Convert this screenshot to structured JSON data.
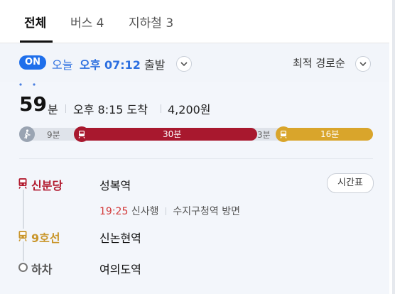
{
  "tabs": [
    {
      "label": "전체",
      "active": true
    },
    {
      "label": "버스 4",
      "active": false
    },
    {
      "label": "지하철 3",
      "active": false
    }
  ],
  "options": {
    "toggle_label": "ON",
    "departure_day": "오늘",
    "departure_time": "오후 07:12",
    "departure_suffix": "출발",
    "sort_label": "최적 경로순"
  },
  "route": {
    "duration_value": "59",
    "duration_unit": "분",
    "arrival": "오후 8:15 도착",
    "fare": "4,200원",
    "segments": {
      "walk_label": "9분",
      "red_label": "30분",
      "transfer_label": "3분",
      "gold_label": "16분"
    },
    "steps": [
      {
        "line": "신분당",
        "station": "성복역",
        "line_color": "#b1192e"
      },
      {
        "line": "9호선",
        "station": "신논현역",
        "line_color": "#c9962b"
      },
      {
        "line": "하차",
        "station": "여의도역",
        "line_color": "#555555"
      }
    ],
    "detail": {
      "time": "19:25",
      "direction": "신사행",
      "exit": "수지구청역 방면"
    },
    "timetable_button": "시간표"
  },
  "colors": {
    "accent_blue": "#1f6feb",
    "shinbundang_red": "#a8182e",
    "line9_gold": "#d9a52b"
  }
}
